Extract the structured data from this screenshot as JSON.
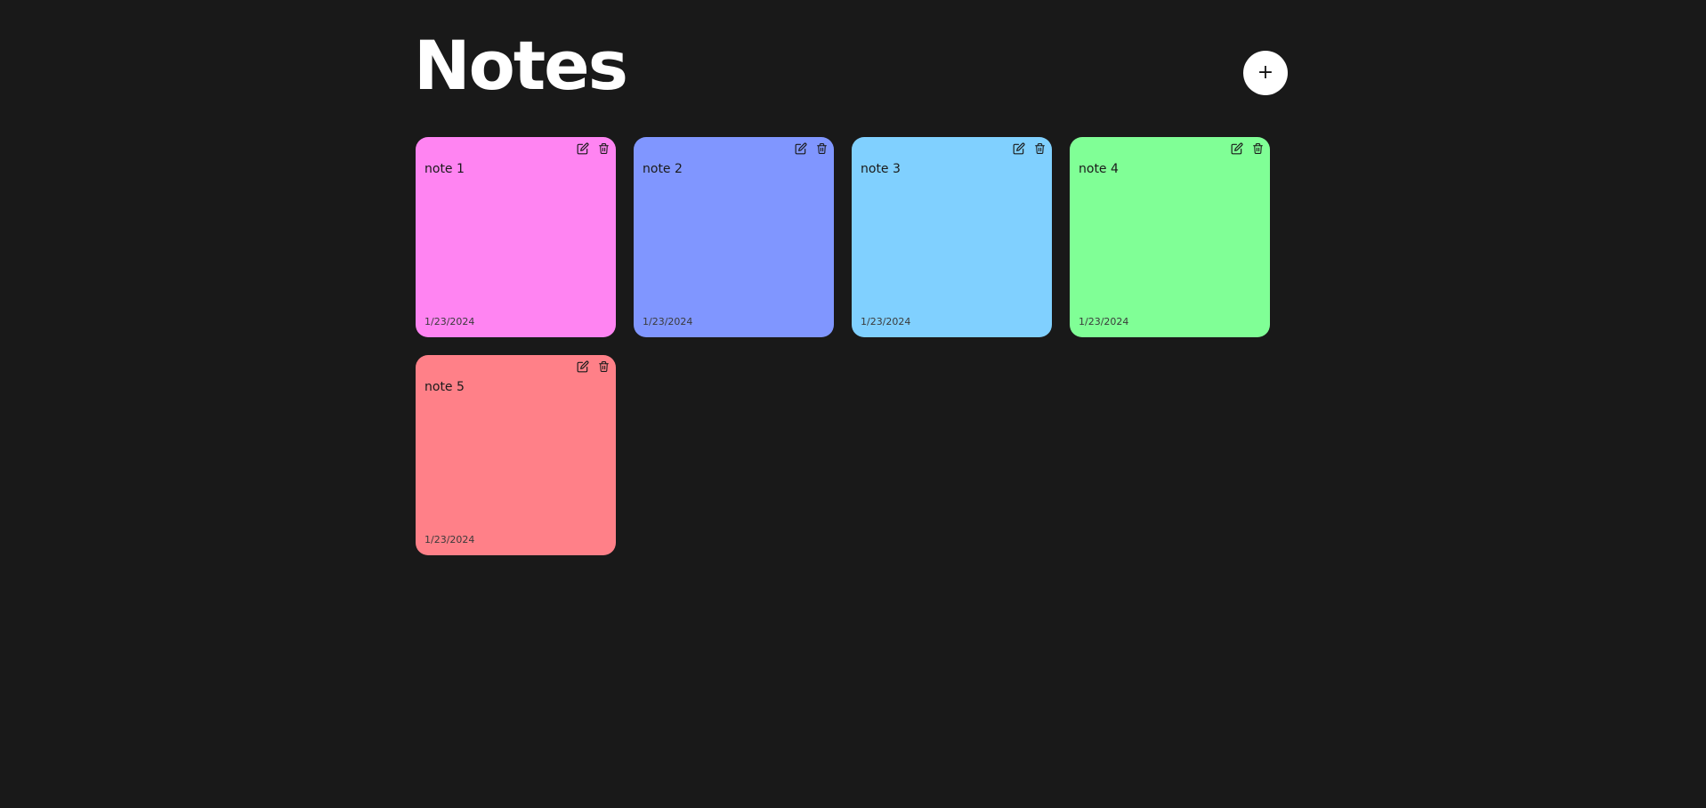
{
  "header": {
    "title": "Notes",
    "add_button_label": "+"
  },
  "notes": [
    {
      "text": "note 1",
      "date": "1/23/2024",
      "color": "#ff84f2",
      "icons": [
        "edit-icon",
        "trash-icon"
      ]
    },
    {
      "text": "note 2",
      "date": "1/23/2024",
      "color": "#8096ff",
      "icons": [
        "edit-icon",
        "trash-icon"
      ]
    },
    {
      "text": "note 3",
      "date": "1/23/2024",
      "color": "#80d0ff",
      "icons": [
        "edit-icon",
        "trash-icon"
      ]
    },
    {
      "text": "note 4",
      "date": "1/23/2024",
      "color": "#80ff96",
      "icons": [
        "edit-icon",
        "trash-icon"
      ]
    },
    {
      "text": "note 5",
      "date": "1/23/2024",
      "color": "#ff8088",
      "icons": [
        "edit-icon",
        "trash-icon"
      ]
    }
  ],
  "colors": {
    "background": "#191919",
    "title": "#ffffff",
    "add_button_bg": "#ffffff"
  }
}
